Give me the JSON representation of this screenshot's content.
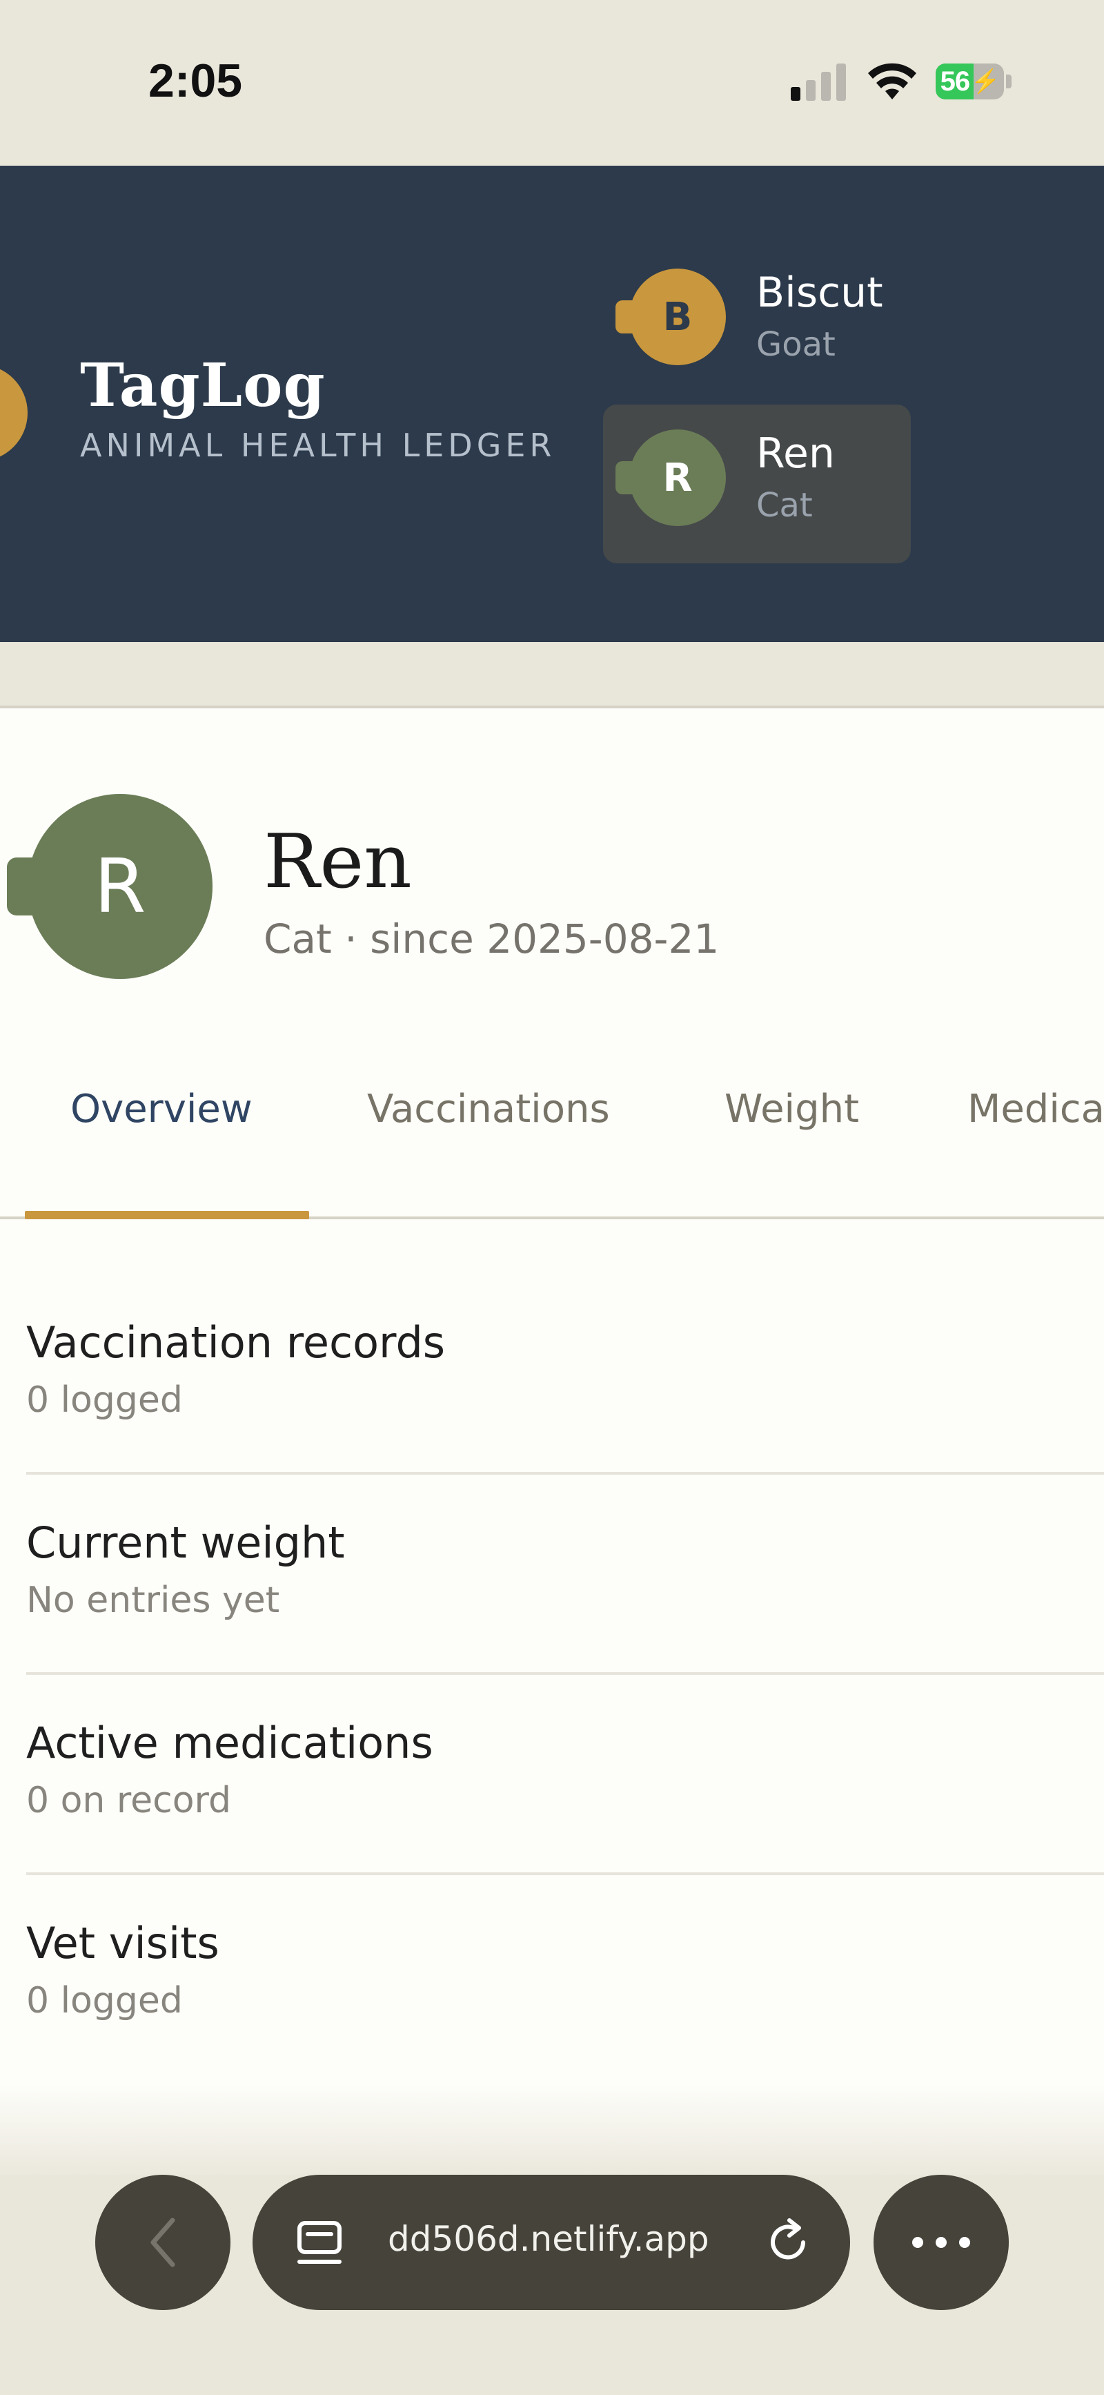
{
  "status_bar": {
    "time": "2:05",
    "battery_percent": 56,
    "battery_label": "56",
    "charging": true,
    "signal_bars": 4,
    "signal_active_bars": 1
  },
  "header": {
    "brand_title": "TagLog",
    "brand_subtitle": "ANIMAL HEALTH LEDGER",
    "animals": [
      {
        "initial": "B",
        "name": "Biscut",
        "species": "Goat",
        "color": "#c9973e",
        "selected": false
      },
      {
        "initial": "R",
        "name": "Ren",
        "species": "Cat",
        "color": "#6b7d57",
        "selected": true
      }
    ]
  },
  "profile": {
    "initial": "R",
    "name": "Ren",
    "meta": "Cat · since 2025-08-21",
    "avatar_color": "#6b7d57"
  },
  "tabs": [
    {
      "label": "Overview",
      "active": true
    },
    {
      "label": "Vaccinations",
      "active": false
    },
    {
      "label": "Weight",
      "active": false
    },
    {
      "label": "Medica",
      "active": false
    }
  ],
  "summary": [
    {
      "label": "Vaccination records",
      "value": "0 logged"
    },
    {
      "label": "Current weight",
      "value": "No entries yet"
    },
    {
      "label": "Active medications",
      "value": "0 on record"
    },
    {
      "label": "Vet visits",
      "value": "0 logged"
    }
  ],
  "browser": {
    "address": "dd506d.netlify.app"
  },
  "colors": {
    "header_bg": "#2c3a4b",
    "accent_gold": "#c9973e",
    "tab_active": "#2f4563",
    "page_bg": "#fdfdf9"
  }
}
